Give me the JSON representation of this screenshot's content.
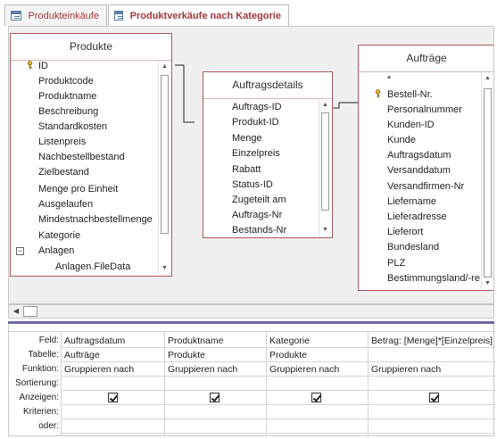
{
  "tabs": [
    {
      "label": "Produkteinkäufe",
      "active": false
    },
    {
      "label": "Produktverkäufe nach Kategorie",
      "active": true
    }
  ],
  "tables": {
    "produkte": {
      "title": "Produkte",
      "fields": [
        "ID",
        "Produktcode",
        "Produktname",
        "Beschreibung",
        "Standardkosten",
        "Listenpreis",
        "Nachbestellbestand",
        "Zielbestand",
        "Menge pro Einheit",
        "Ausgelaufen",
        "Mindestnachbestellmenge",
        "Kategorie",
        "Anlagen",
        "Anlagen.FileData"
      ]
    },
    "auftragsdetails": {
      "title": "Auftragsdetails",
      "fields": [
        "Auftrags-ID",
        "Produkt-ID",
        "Menge",
        "Einzelpreis",
        "Rabatt",
        "Status-ID",
        "Zugeteilt am",
        "Auftrags-Nr",
        "Bestands-Nr"
      ]
    },
    "auftraege": {
      "title": "Aufträge",
      "fields": [
        "*",
        "Bestell-Nr.",
        "Personalnummer",
        "Kunden-ID",
        "Kunde",
        "Auftragsdatum",
        "Versanddatum",
        "Versandfirmen-Nr",
        "Liefername",
        "Lieferadresse",
        "Lieferort",
        "Bundesland",
        "PLZ",
        "Bestimmungsland/-re"
      ]
    }
  },
  "grid": {
    "row_labels": [
      "Feld:",
      "Tabelle:",
      "Funktion:",
      "Sortierung:",
      "Anzeigen:",
      "Kriterien:",
      "oder:"
    ],
    "columns": [
      {
        "feld": "Auftragsdatum",
        "tabelle": "Aufträge",
        "funktion": "Gruppieren nach",
        "anzeigen": true
      },
      {
        "feld": "Produktname",
        "tabelle": "Produkte",
        "funktion": "Gruppieren nach",
        "anzeigen": true
      },
      {
        "feld": "Kategorie",
        "tabelle": "Produkte",
        "funktion": "Gruppieren nach",
        "anzeigen": true
      },
      {
        "feld": "Betrag: [Menge]*[Einzelpreis]",
        "tabelle": "",
        "funktion": "Gruppieren nach",
        "anzeigen": true
      }
    ]
  },
  "colors": {
    "accent": "#a4373a",
    "table_border": "#b0595c",
    "splitter": "#6a6aa8"
  }
}
